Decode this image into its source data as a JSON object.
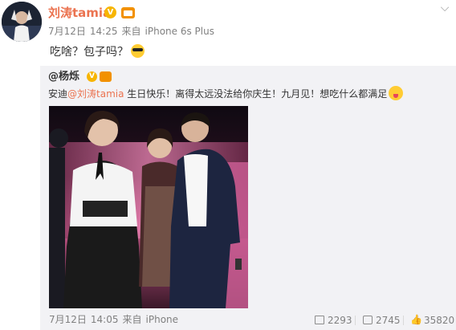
{
  "post": {
    "author": "刘涛tamia",
    "verified_badge": "V",
    "date": "7月12日",
    "time": "14:25",
    "source_prefix": "来自",
    "source": "iPhone 6s Plus",
    "text": "吃啥？包子吗？",
    "text_emoji": "cool-sunglasses-emoji"
  },
  "repost": {
    "author": "@杨烁",
    "verified_badge": "V",
    "text_prefix": "安迪",
    "mention": "@刘涛tamia",
    "text_body": " 生日快乐！离得太远没法给你庆生！九月见！想吃什么都满足",
    "text_emoji": "tongue-out-emoji",
    "date": "7月12日",
    "time": "14:05",
    "source_prefix": "来自",
    "source": "iPhone",
    "stats": {
      "reposts": "2293",
      "comments": "2745",
      "likes": "35820"
    }
  },
  "colors": {
    "accent": "#eb7350",
    "verified": "#f7b500",
    "repost_background": "#f2f2f5",
    "meta_text": "#808080"
  }
}
